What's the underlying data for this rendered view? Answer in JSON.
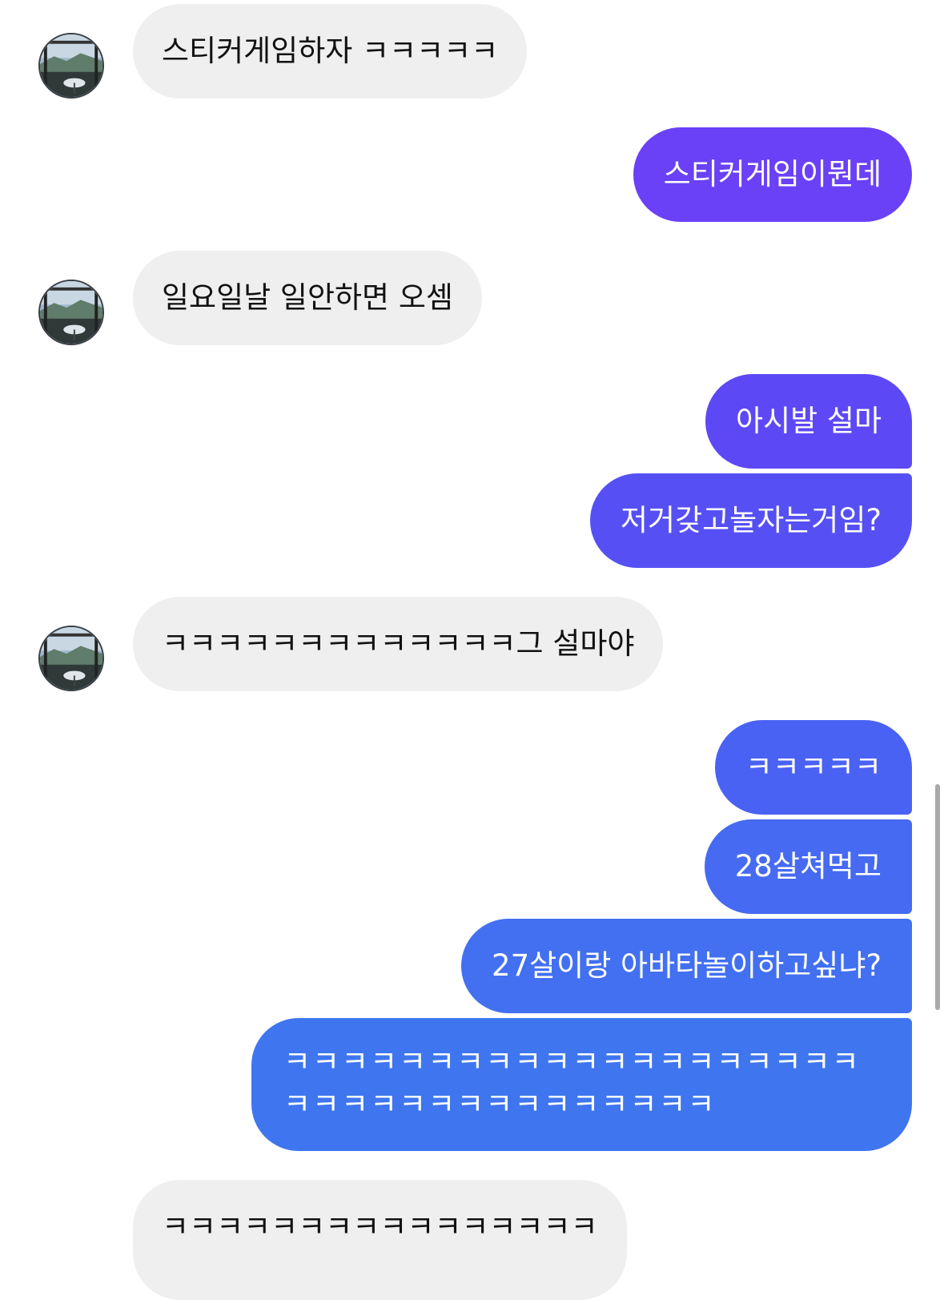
{
  "messages": [
    {
      "side": "in",
      "text": "스티커게임하자 ㅋㅋㅋㅋㅋ"
    },
    {
      "side": "out",
      "text": "스티커게임이뭔데"
    },
    {
      "side": "in",
      "text": "일요일날 일안하면 오셈"
    },
    {
      "side": "out",
      "text": "아시발 설마"
    },
    {
      "side": "out",
      "text": "저거갖고놀자는거임?"
    },
    {
      "side": "in",
      "text": "ㅋㅋㅋㅋㅋㅋㅋㅋㅋㅋㅋㅋㅋ그 설마야"
    },
    {
      "side": "out",
      "text": "ㅋㅋㅋㅋㅋ"
    },
    {
      "side": "out",
      "text": "28살쳐먹고"
    },
    {
      "side": "out",
      "text": "27살이랑 아바타놀이하고싶냐?"
    },
    {
      "side": "out",
      "text": "ㅋㅋㅋㅋㅋㅋㅋㅋㅋㅋㅋㅋㅋㅋㅋㅋㅋㅋㅋㅋㅋㅋㅋㅋㅋㅋㅋㅋㅋㅋㅋㅋㅋㅋㅋ"
    },
    {
      "side": "in",
      "text": "ㅋㅋㅋㅋㅋㅋㅋㅋㅋㅋㅋㅋㅋㅋㅋㅋ"
    }
  ],
  "colors": {
    "incoming_bubble": "#efefef",
    "outgoing_gradient_top": "#6a3ef6",
    "outgoing_gradient_bottom": "#3f78ef"
  },
  "avatar": {
    "icon": "profile-photo-avatar"
  }
}
